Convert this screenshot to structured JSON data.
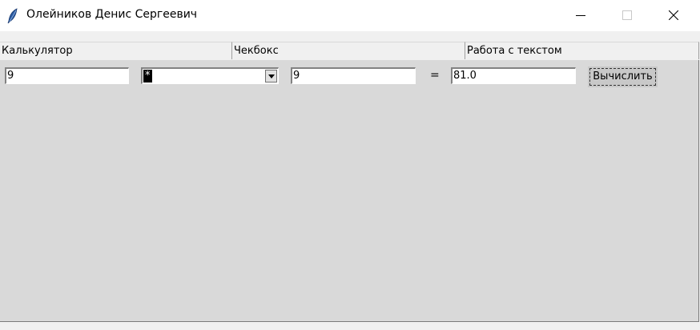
{
  "window": {
    "title": "Олейников Денис Сергеевич",
    "icon": "feather-icon"
  },
  "tabs": [
    {
      "label": "Калькулятор"
    },
    {
      "label": "Чекбокс"
    },
    {
      "label": "Работа с текстом"
    }
  ],
  "calculator": {
    "operand1": "9",
    "operator": "*",
    "operand2": "9",
    "equals": "=",
    "result": "81.0",
    "button_label": "Вычислить"
  },
  "colors": {
    "panel_bg": "#d9d9d9",
    "window_bg": "#f0f0f0",
    "titlebar_bg": "#ffffff"
  }
}
